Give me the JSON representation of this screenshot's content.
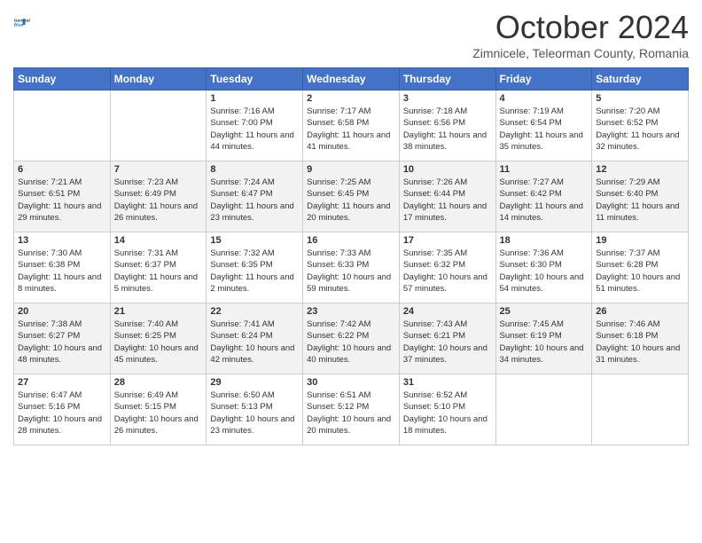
{
  "header": {
    "logo_line1": "General",
    "logo_line2": "Blue",
    "month": "October 2024",
    "location": "Zimnicele, Teleorman County, Romania"
  },
  "weekdays": [
    "Sunday",
    "Monday",
    "Tuesday",
    "Wednesday",
    "Thursday",
    "Friday",
    "Saturday"
  ],
  "weeks": [
    [
      {
        "day": "",
        "info": ""
      },
      {
        "day": "",
        "info": ""
      },
      {
        "day": "1",
        "sunrise": "Sunrise: 7:16 AM",
        "sunset": "Sunset: 7:00 PM",
        "daylight": "Daylight: 11 hours and 44 minutes."
      },
      {
        "day": "2",
        "sunrise": "Sunrise: 7:17 AM",
        "sunset": "Sunset: 6:58 PM",
        "daylight": "Daylight: 11 hours and 41 minutes."
      },
      {
        "day": "3",
        "sunrise": "Sunrise: 7:18 AM",
        "sunset": "Sunset: 6:56 PM",
        "daylight": "Daylight: 11 hours and 38 minutes."
      },
      {
        "day": "4",
        "sunrise": "Sunrise: 7:19 AM",
        "sunset": "Sunset: 6:54 PM",
        "daylight": "Daylight: 11 hours and 35 minutes."
      },
      {
        "day": "5",
        "sunrise": "Sunrise: 7:20 AM",
        "sunset": "Sunset: 6:52 PM",
        "daylight": "Daylight: 11 hours and 32 minutes."
      }
    ],
    [
      {
        "day": "6",
        "sunrise": "Sunrise: 7:21 AM",
        "sunset": "Sunset: 6:51 PM",
        "daylight": "Daylight: 11 hours and 29 minutes."
      },
      {
        "day": "7",
        "sunrise": "Sunrise: 7:23 AM",
        "sunset": "Sunset: 6:49 PM",
        "daylight": "Daylight: 11 hours and 26 minutes."
      },
      {
        "day": "8",
        "sunrise": "Sunrise: 7:24 AM",
        "sunset": "Sunset: 6:47 PM",
        "daylight": "Daylight: 11 hours and 23 minutes."
      },
      {
        "day": "9",
        "sunrise": "Sunrise: 7:25 AM",
        "sunset": "Sunset: 6:45 PM",
        "daylight": "Daylight: 11 hours and 20 minutes."
      },
      {
        "day": "10",
        "sunrise": "Sunrise: 7:26 AM",
        "sunset": "Sunset: 6:44 PM",
        "daylight": "Daylight: 11 hours and 17 minutes."
      },
      {
        "day": "11",
        "sunrise": "Sunrise: 7:27 AM",
        "sunset": "Sunset: 6:42 PM",
        "daylight": "Daylight: 11 hours and 14 minutes."
      },
      {
        "day": "12",
        "sunrise": "Sunrise: 7:29 AM",
        "sunset": "Sunset: 6:40 PM",
        "daylight": "Daylight: 11 hours and 11 minutes."
      }
    ],
    [
      {
        "day": "13",
        "sunrise": "Sunrise: 7:30 AM",
        "sunset": "Sunset: 6:38 PM",
        "daylight": "Daylight: 11 hours and 8 minutes."
      },
      {
        "day": "14",
        "sunrise": "Sunrise: 7:31 AM",
        "sunset": "Sunset: 6:37 PM",
        "daylight": "Daylight: 11 hours and 5 minutes."
      },
      {
        "day": "15",
        "sunrise": "Sunrise: 7:32 AM",
        "sunset": "Sunset: 6:35 PM",
        "daylight": "Daylight: 11 hours and 2 minutes."
      },
      {
        "day": "16",
        "sunrise": "Sunrise: 7:33 AM",
        "sunset": "Sunset: 6:33 PM",
        "daylight": "Daylight: 10 hours and 59 minutes."
      },
      {
        "day": "17",
        "sunrise": "Sunrise: 7:35 AM",
        "sunset": "Sunset: 6:32 PM",
        "daylight": "Daylight: 10 hours and 57 minutes."
      },
      {
        "day": "18",
        "sunrise": "Sunrise: 7:36 AM",
        "sunset": "Sunset: 6:30 PM",
        "daylight": "Daylight: 10 hours and 54 minutes."
      },
      {
        "day": "19",
        "sunrise": "Sunrise: 7:37 AM",
        "sunset": "Sunset: 6:28 PM",
        "daylight": "Daylight: 10 hours and 51 minutes."
      }
    ],
    [
      {
        "day": "20",
        "sunrise": "Sunrise: 7:38 AM",
        "sunset": "Sunset: 6:27 PM",
        "daylight": "Daylight: 10 hours and 48 minutes."
      },
      {
        "day": "21",
        "sunrise": "Sunrise: 7:40 AM",
        "sunset": "Sunset: 6:25 PM",
        "daylight": "Daylight: 10 hours and 45 minutes."
      },
      {
        "day": "22",
        "sunrise": "Sunrise: 7:41 AM",
        "sunset": "Sunset: 6:24 PM",
        "daylight": "Daylight: 10 hours and 42 minutes."
      },
      {
        "day": "23",
        "sunrise": "Sunrise: 7:42 AM",
        "sunset": "Sunset: 6:22 PM",
        "daylight": "Daylight: 10 hours and 40 minutes."
      },
      {
        "day": "24",
        "sunrise": "Sunrise: 7:43 AM",
        "sunset": "Sunset: 6:21 PM",
        "daylight": "Daylight: 10 hours and 37 minutes."
      },
      {
        "day": "25",
        "sunrise": "Sunrise: 7:45 AM",
        "sunset": "Sunset: 6:19 PM",
        "daylight": "Daylight: 10 hours and 34 minutes."
      },
      {
        "day": "26",
        "sunrise": "Sunrise: 7:46 AM",
        "sunset": "Sunset: 6:18 PM",
        "daylight": "Daylight: 10 hours and 31 minutes."
      }
    ],
    [
      {
        "day": "27",
        "sunrise": "Sunrise: 6:47 AM",
        "sunset": "Sunset: 5:16 PM",
        "daylight": "Daylight: 10 hours and 28 minutes."
      },
      {
        "day": "28",
        "sunrise": "Sunrise: 6:49 AM",
        "sunset": "Sunset: 5:15 PM",
        "daylight": "Daylight: 10 hours and 26 minutes."
      },
      {
        "day": "29",
        "sunrise": "Sunrise: 6:50 AM",
        "sunset": "Sunset: 5:13 PM",
        "daylight": "Daylight: 10 hours and 23 minutes."
      },
      {
        "day": "30",
        "sunrise": "Sunrise: 6:51 AM",
        "sunset": "Sunset: 5:12 PM",
        "daylight": "Daylight: 10 hours and 20 minutes."
      },
      {
        "day": "31",
        "sunrise": "Sunrise: 6:52 AM",
        "sunset": "Sunset: 5:10 PM",
        "daylight": "Daylight: 10 hours and 18 minutes."
      },
      {
        "day": "",
        "info": ""
      },
      {
        "day": "",
        "info": ""
      }
    ]
  ]
}
